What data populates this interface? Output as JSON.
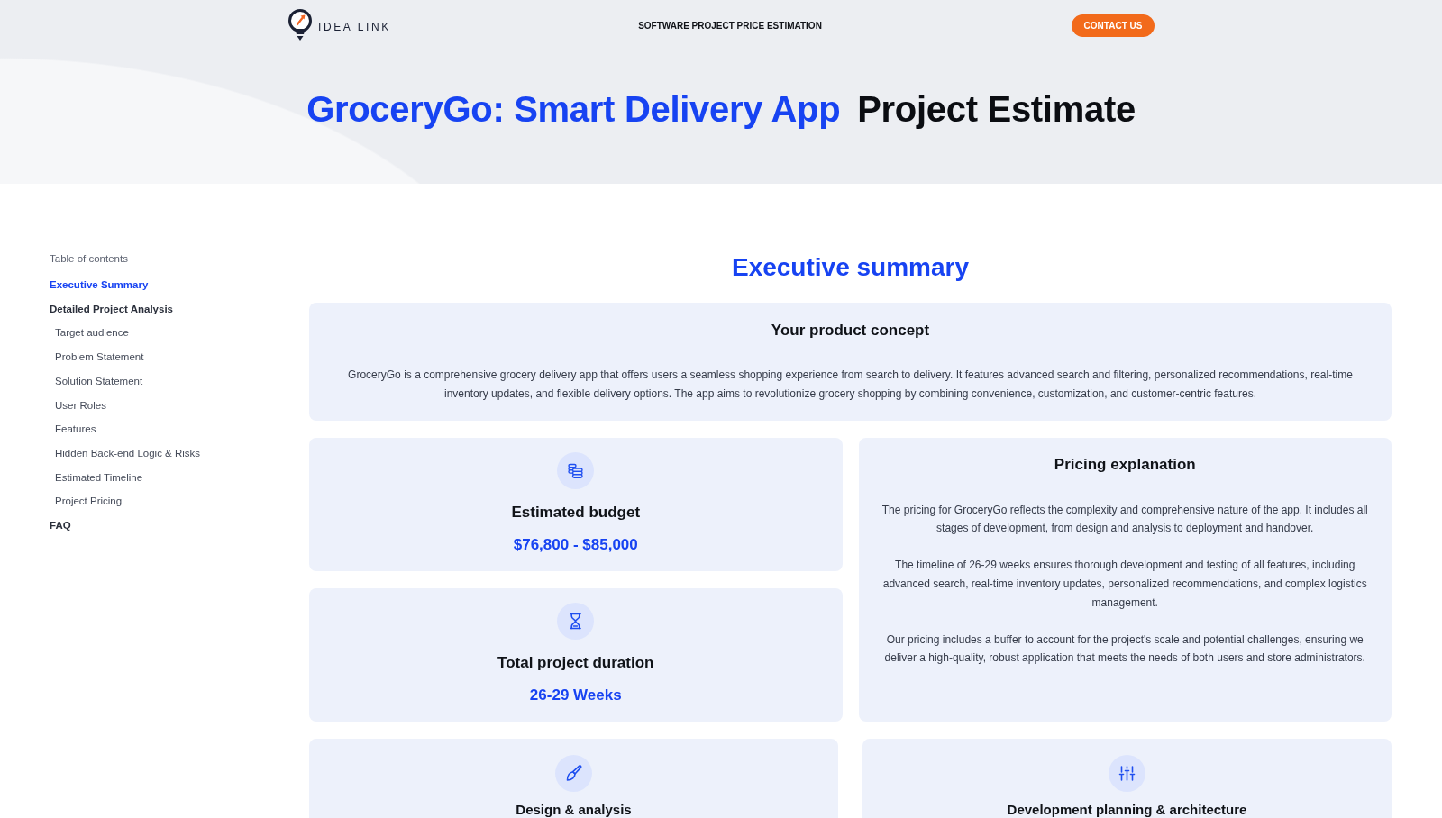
{
  "header": {
    "logo": "IDEA LINK",
    "tagline": "SOFTWARE PROJECT PRICE ESTIMATION",
    "contact_button": "CONTACT US"
  },
  "hero": {
    "title_highlight": "GroceryGo: Smart Delivery App",
    "title_rest": "Project Estimate"
  },
  "sidebar": {
    "title": "Table of contents",
    "items": [
      {
        "label": "Executive Summary",
        "selected": true
      },
      {
        "label": "Detailed Project Analysis",
        "selected": false,
        "children": [
          {
            "label": "Target audience",
            "selected": false
          },
          {
            "label": "Problem Statement",
            "selected": false
          },
          {
            "label": "Solution Statement",
            "selected": false
          },
          {
            "label": "User Roles",
            "selected": false
          },
          {
            "label": "Features",
            "selected": false
          },
          {
            "label": "Hidden Back-end Logic & Risks",
            "selected": false
          },
          {
            "label": "Estimated Timeline",
            "selected": false
          },
          {
            "label": "Project Pricing",
            "selected": false
          }
        ]
      },
      {
        "label": "FAQ",
        "selected": false
      }
    ]
  },
  "main": {
    "heading": "Executive summary",
    "concept": {
      "title": "Your product concept",
      "text": "GroceryGo is a comprehensive grocery delivery app that offers users a seamless shopping experience from search to delivery. It features advanced search and filtering, personalized recommendations, real-time inventory updates, and flexible delivery options. The app aims to revolutionize grocery shopping by combining convenience, customization, and customer-centric features."
    },
    "stats": [
      {
        "title": "Estimated budget",
        "value": "$76,800 - $85,000"
      },
      {
        "title": "Total project duration",
        "value": "26-29 Weeks"
      }
    ],
    "pricing": {
      "title": "Pricing explanation",
      "paragraphs": [
        "The pricing for GroceryGo reflects the complexity and comprehensive nature of the app. It includes all stages of development, from design and analysis to deployment and handover.",
        "The timeline of 26-29 weeks ensures thorough development and testing of all features, including advanced search, real-time inventory updates, personalized recommendations, and complex logistics management.",
        "Our pricing includes a buffer to account for the project's scale and potential challenges, ensuring we deliver a high-quality, robust application that meets the needs of both users and store administrators."
      ]
    },
    "phases": [
      {
        "title": "Design & analysis"
      },
      {
        "title": "Development planning & architecture"
      }
    ]
  }
}
